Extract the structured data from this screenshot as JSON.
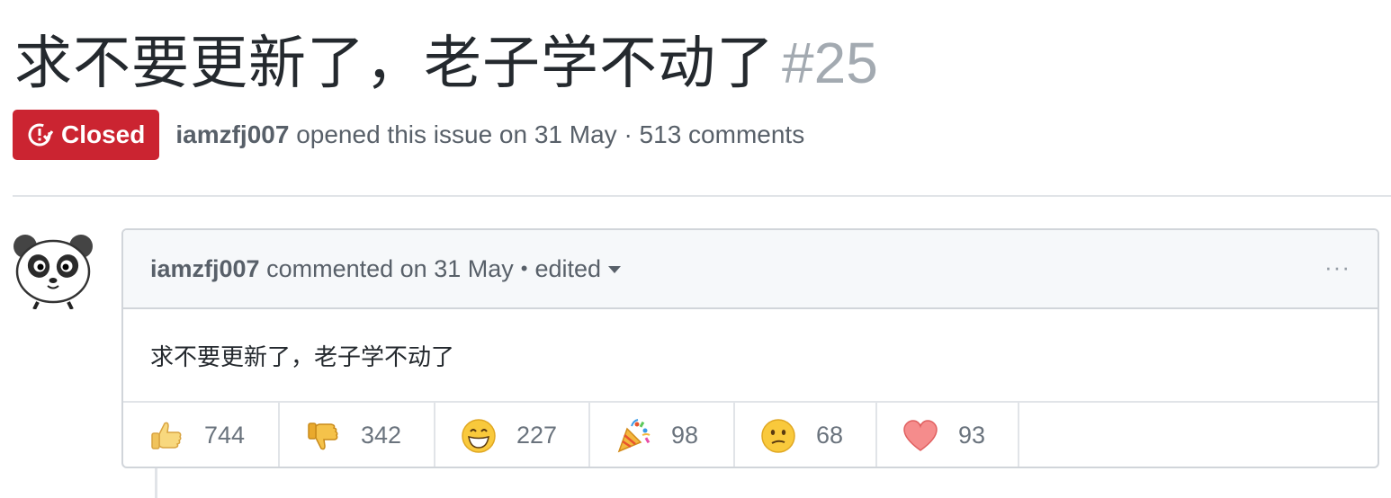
{
  "issue": {
    "title": "求不要更新了，老子学不动了",
    "number": "#25",
    "state": "Closed",
    "author": "iamzfj007",
    "opened_text": "opened this issue on 31 May · 513 comments"
  },
  "comment": {
    "author": "iamzfj007",
    "action_text": "commented on 31 May",
    "bullet": "•",
    "edited_label": "edited",
    "more_label": "···",
    "body": "求不要更新了，老子学不动了"
  },
  "reactions": [
    {
      "icon": "thumbs-up-icon",
      "count": "744"
    },
    {
      "icon": "thumbs-down-icon",
      "count": "342"
    },
    {
      "icon": "laugh-icon",
      "count": "227"
    },
    {
      "icon": "hooray-icon",
      "count": "98"
    },
    {
      "icon": "confused-icon",
      "count": "68"
    },
    {
      "icon": "heart-icon",
      "count": "93"
    }
  ],
  "colors": {
    "closed_badge": "#cb2431",
    "muted_text": "#586069",
    "issue_number": "#a3aab1",
    "border": "#d1d5da",
    "header_bg": "#f6f8fa"
  }
}
